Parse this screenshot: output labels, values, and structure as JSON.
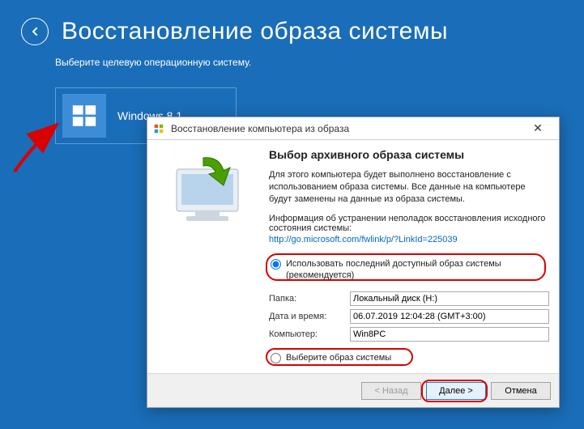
{
  "header": {
    "title": "Восстановление образа системы",
    "subtitle": "Выберите целевую операционную систему."
  },
  "os_tile": {
    "name": "Windows 8.1"
  },
  "dialog": {
    "title": "Восстановление компьютера из образа",
    "heading": "Выбор архивного образа системы",
    "description": "Для этого компьютера будет выполнено восстановление с использованием образа системы. Все данные на компьютере будут заменены на данные из образа системы.",
    "info_line": "Информация об устранении неполадок восстановления исходного состояния системы:",
    "info_url": "http://go.microsoft.com/fwlink/p/?LinkId=225039",
    "radio1_label": "Использовать последний доступный образ системы (рекомендуется)",
    "radio2_label": "Выберите образ системы",
    "fields": {
      "folder_label": "Папка:",
      "folder_value": "Локальный диск (H:)",
      "datetime_label": "Дата и время:",
      "datetime_value": "06.07.2019 12:04:28 (GMT+3:00)",
      "computer_label": "Компьютер:",
      "computer_value": "Win8PC"
    },
    "buttons": {
      "back": "< Назад",
      "next": "Далее >",
      "cancel": "Отмена"
    }
  }
}
